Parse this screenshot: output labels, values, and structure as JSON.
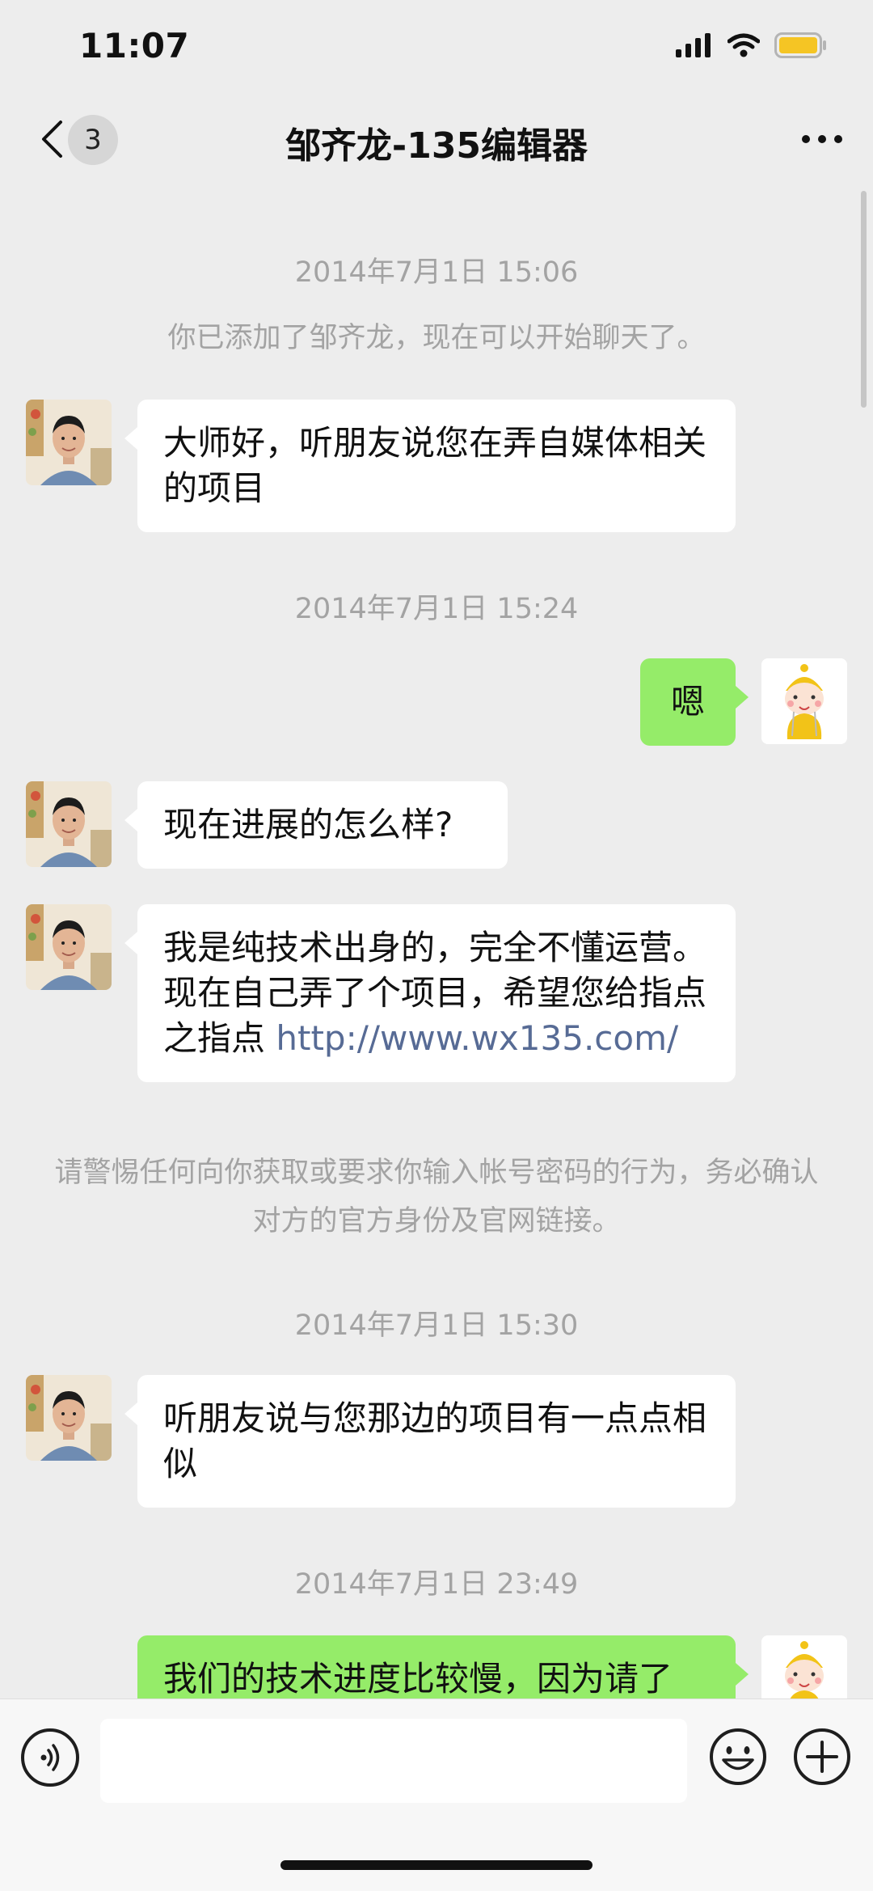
{
  "status_bar": {
    "time": "11:07"
  },
  "header": {
    "unread_count": "3",
    "title": "邹齐龙-135编辑器"
  },
  "messages": [
    {
      "type": "timestamp",
      "text": "2014年7月1日 15:06"
    },
    {
      "type": "system",
      "text": "你已添加了邹齐龙，现在可以开始聊天了。"
    },
    {
      "type": "incoming",
      "text": "大师好，听朋友说您在弄自媒体相关的项目"
    },
    {
      "type": "timestamp",
      "text": "2014年7月1日 15:24"
    },
    {
      "type": "outgoing",
      "text": "嗯"
    },
    {
      "type": "incoming",
      "text": "现在进展的怎么样?"
    },
    {
      "type": "incoming",
      "text": "我是纯技术出身的，完全不懂运营。现在自己弄了个项目，希望您给指点之指点 ",
      "link": "http://www.wx135.com/"
    },
    {
      "type": "system",
      "text": "请警惕任何向你获取或要求你输入帐号密码的行为，务必确认对方的官方身份及官网链接。"
    },
    {
      "type": "timestamp",
      "text": "2014年7月1日 15:30"
    },
    {
      "type": "incoming",
      "text": "听朋友说与您那边的项目有一点点相似"
    },
    {
      "type": "timestamp",
      "text": "2014年7月1日 23:49"
    },
    {
      "type": "outgoing",
      "text": "我们的技术进度比较慢，因为请了"
    }
  ],
  "input": {
    "value": "",
    "placeholder": ""
  },
  "colors": {
    "background": "#ededed",
    "outgoing_bubble": "#95ec69",
    "incoming_bubble": "#ffffff",
    "link": "#576b95",
    "timestamp_text": "#a3a3a3"
  }
}
